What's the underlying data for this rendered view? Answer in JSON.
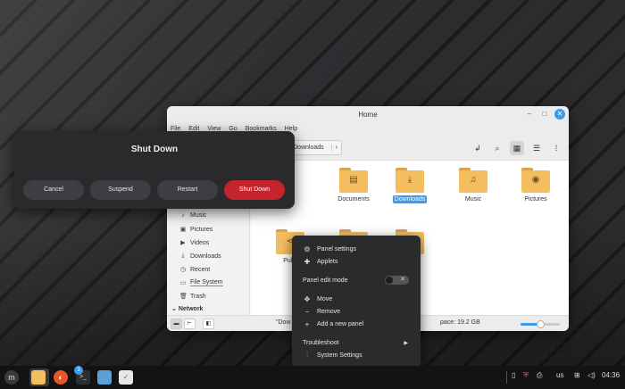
{
  "file_manager": {
    "title": "Home",
    "menu": [
      "File",
      "Edit",
      "View",
      "Go",
      "Bookmarks",
      "Help"
    ],
    "breadcrumb": "Downloads",
    "sidebar": {
      "items": [
        {
          "label": "Music",
          "icon": "music-note-icon"
        },
        {
          "label": "Pictures",
          "icon": "image-icon"
        },
        {
          "label": "Videos",
          "icon": "video-icon"
        },
        {
          "label": "Downloads",
          "icon": "download-icon"
        },
        {
          "label": "Recent",
          "icon": "clock-icon"
        },
        {
          "label": "File System",
          "icon": "drive-icon"
        },
        {
          "label": "Trash",
          "icon": "trash-icon"
        }
      ],
      "network_heading": "Network"
    },
    "files": [
      {
        "label": "Documents",
        "icon": "document-icon"
      },
      {
        "label": "Downloads",
        "icon": "download-icon",
        "selected": true
      },
      {
        "label": "Music",
        "icon": "music-note-icon"
      },
      {
        "label": "Pictures",
        "icon": "camera-icon"
      },
      {
        "label": "Publi",
        "icon": "share-icon"
      }
    ],
    "status_text": "\"Dow",
    "status_space": "pace: 19.2 GB",
    "zoom_fraction": 0.5
  },
  "shutdown_dialog": {
    "title": "Shut Down",
    "buttons": {
      "cancel": "Cancel",
      "suspend": "Suspend",
      "restart": "Restart",
      "shutdown": "Shut Down"
    }
  },
  "context_menu": {
    "panel_settings": "Panel settings",
    "applets": "Applets",
    "panel_edit_mode": "Panel edit mode",
    "move": "Move",
    "remove": "Remove",
    "add_panel": "Add a new panel",
    "troubleshoot": "Troubleshoot",
    "system_settings": "System Settings",
    "toggle_off": "✕"
  },
  "taskbar": {
    "terminal_badge": "3",
    "keyboard_layout": "us",
    "clock": "04:36"
  },
  "colors": {
    "accent": "#3d9be9",
    "danger": "#c4242c",
    "folder": "#f3bd60"
  }
}
